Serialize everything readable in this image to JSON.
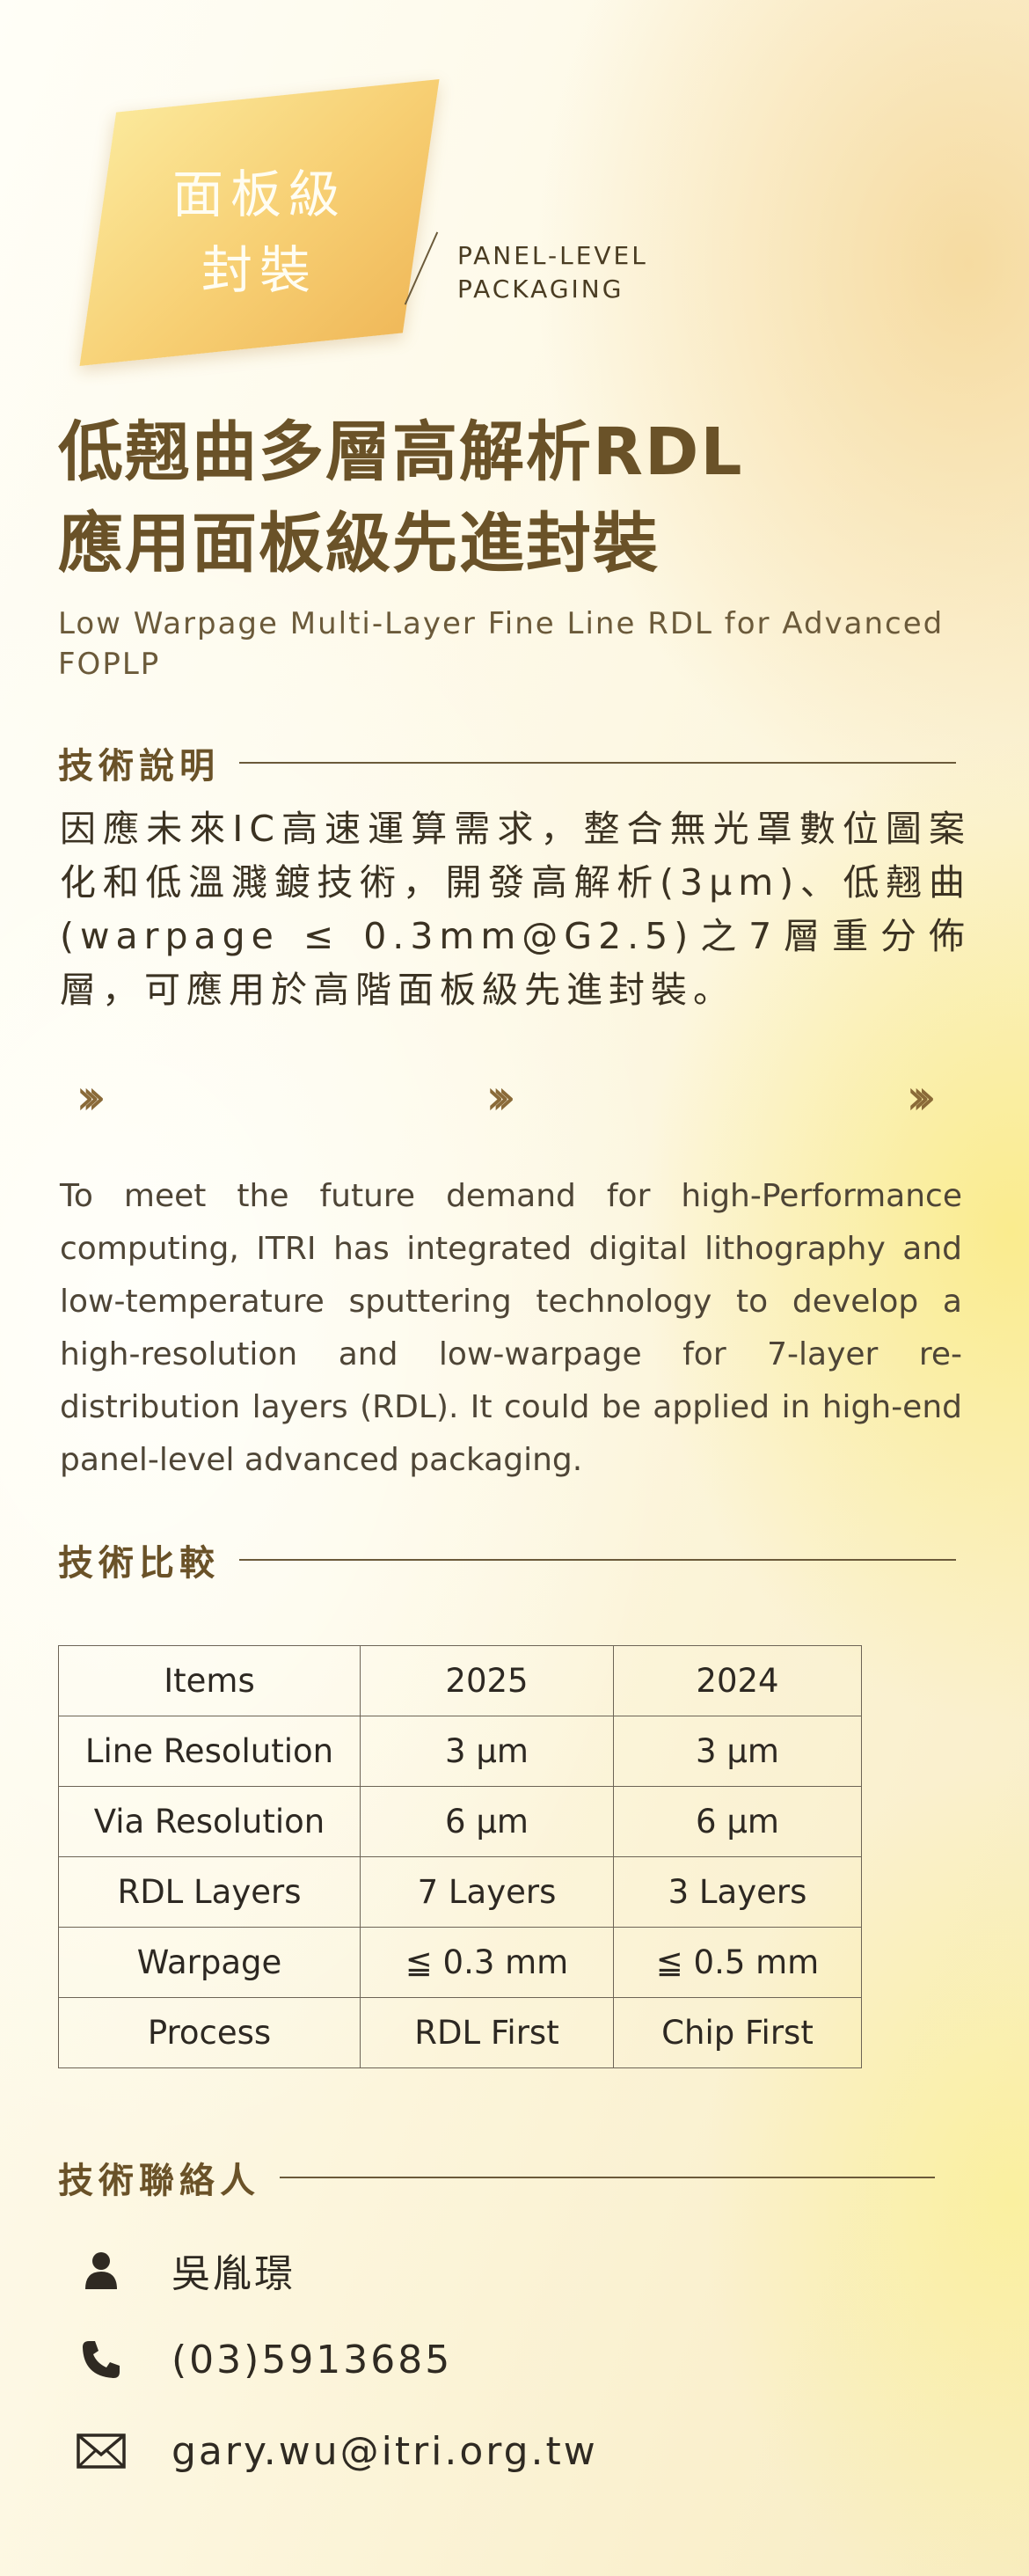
{
  "badge": {
    "zh_line1": "面板級",
    "zh_line2": "封裝",
    "en_line1": "PANEL-LEVEL",
    "en_line2": "PACKAGING"
  },
  "title": {
    "line1": "低翹曲多層高解析RDL",
    "line2": "應用面板級先進封裝"
  },
  "subtitle": "Low Warpage Multi-Layer Fine Line RDL for Advanced FOPLP",
  "tech_description": {
    "heading": "技術說明",
    "zh_text": "因應未來IC高速運算需求，整合無光罩數位圖案化和低溫濺鍍技術，開發高解析(3μm)、低翹曲(warpage ≤ 0.3mm@G2.5)之7層重分佈層，可應用於高階面板級先進封裝。",
    "en_text": "To meet the future demand for high-Performance computing, ITRI has integrated digital lithography and low-temperature sputtering technology to develop a high-resolution and low-warpage for 7-layer re-distribution layers (RDL). It could be applied in high-end panel-level advanced packaging.",
    "chevron_icon": "triple-chevron-right-icon"
  },
  "tech_comparison": {
    "heading": "技術比較",
    "header": [
      "Items",
      "2025",
      "2024"
    ],
    "rows": [
      [
        "Line Resolution",
        "3 μm",
        "3 μm"
      ],
      [
        "Via Resolution",
        "6 μm",
        "6 μm"
      ],
      [
        "RDL Layers",
        "7 Layers",
        "3 Layers"
      ],
      [
        "Warpage",
        "≦ 0.3 mm",
        "≦ 0.5 mm"
      ],
      [
        "Process",
        "RDL First",
        "Chip First"
      ]
    ]
  },
  "contact": {
    "heading": "技術聯絡人",
    "name": "吳胤璟",
    "phone": "(03)5913685",
    "email": "gary.wu@itri.org.tw",
    "icons": [
      "person-icon",
      "phone-icon",
      "mail-icon"
    ]
  },
  "colors": {
    "heading": "#6a5228",
    "body": "#3b3222",
    "line": "#6b5a3a",
    "badge": "#f7cf73"
  }
}
